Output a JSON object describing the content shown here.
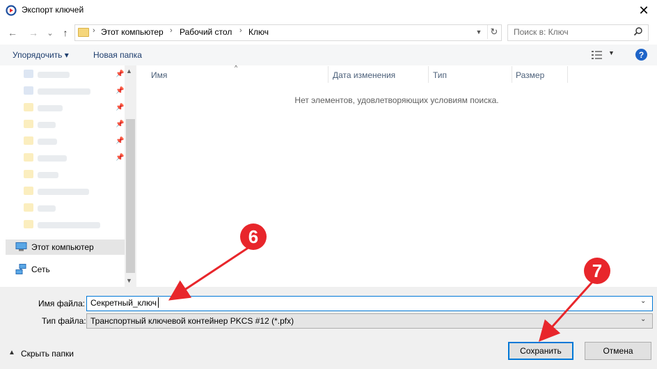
{
  "window": {
    "title": "Экспорт ключей",
    "close_glyph": "✕"
  },
  "nav_buttons": {
    "back": "←",
    "forward": "→",
    "recent": "⌄",
    "up": "↑"
  },
  "breadcrumb": [
    "Этот компьютер",
    "Рабочий стол",
    "Ключ"
  ],
  "breadcrumb_sep": "›",
  "search": {
    "placeholder": "Поиск в: Ключ"
  },
  "toolbar": {
    "organize": "Упорядочить ▾",
    "new_folder": "Новая папка",
    "help": "?"
  },
  "sidebar": {
    "this_pc": "Этот компьютер",
    "network": "Сеть"
  },
  "columns": [
    "Имя",
    "Дата изменения",
    "Тип",
    "Размер"
  ],
  "empty_message": "Нет элементов, удовлетворяющих условиям поиска.",
  "form": {
    "filename_label": "Имя файла:",
    "filename_value": "Секретный_ключ",
    "filetype_label": "Тип файла:",
    "filetype_value": "Транспортный ключевой контейнер PKCS #12 (*.pfx)"
  },
  "footer": {
    "hide_folders": "Скрыть папки",
    "save": "Сохранить",
    "cancel": "Отмена"
  },
  "annotations": {
    "step_a": "6",
    "step_b": "7"
  },
  "colors": {
    "accent": "#0078d7",
    "annotation": "#e8262b",
    "link": "#1e3e6e"
  }
}
